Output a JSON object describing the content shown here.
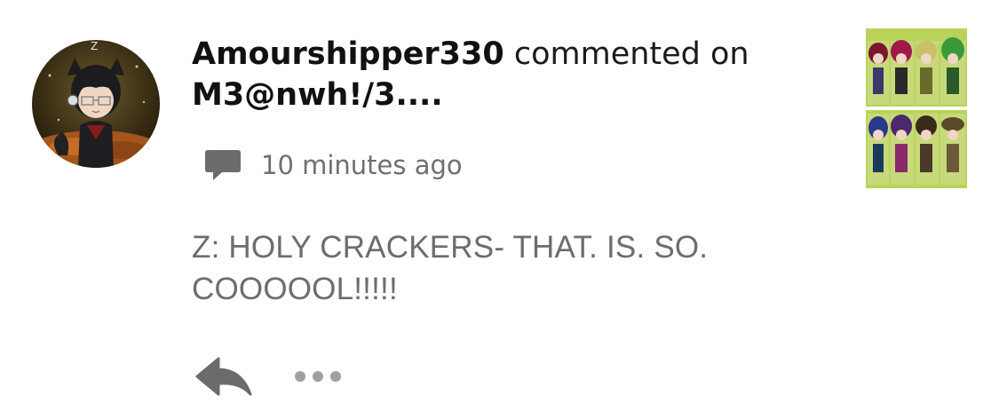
{
  "comment": {
    "username": "Amourshipper330",
    "action_text": "commented on",
    "post_title": "M3@nwh!/3....",
    "timestamp": "10 minutes ago",
    "text": "Z: HOLY CRACKERS- THAT. IS. SO. COOOOOL!!!!!",
    "avatar_letter": "Z"
  },
  "icons": {
    "comment": "comment-bubble-icon",
    "reply": "reply-arrow-icon",
    "more": "more-dots-icon"
  },
  "colors": {
    "username": "#111111",
    "meta_text": "#6f6f6f",
    "body_text": "#6d6d6d",
    "icon_gray": "#6b6b6b",
    "dots_gray": "#a0a0a0",
    "thumbnail_bg": "#b9d35a"
  }
}
